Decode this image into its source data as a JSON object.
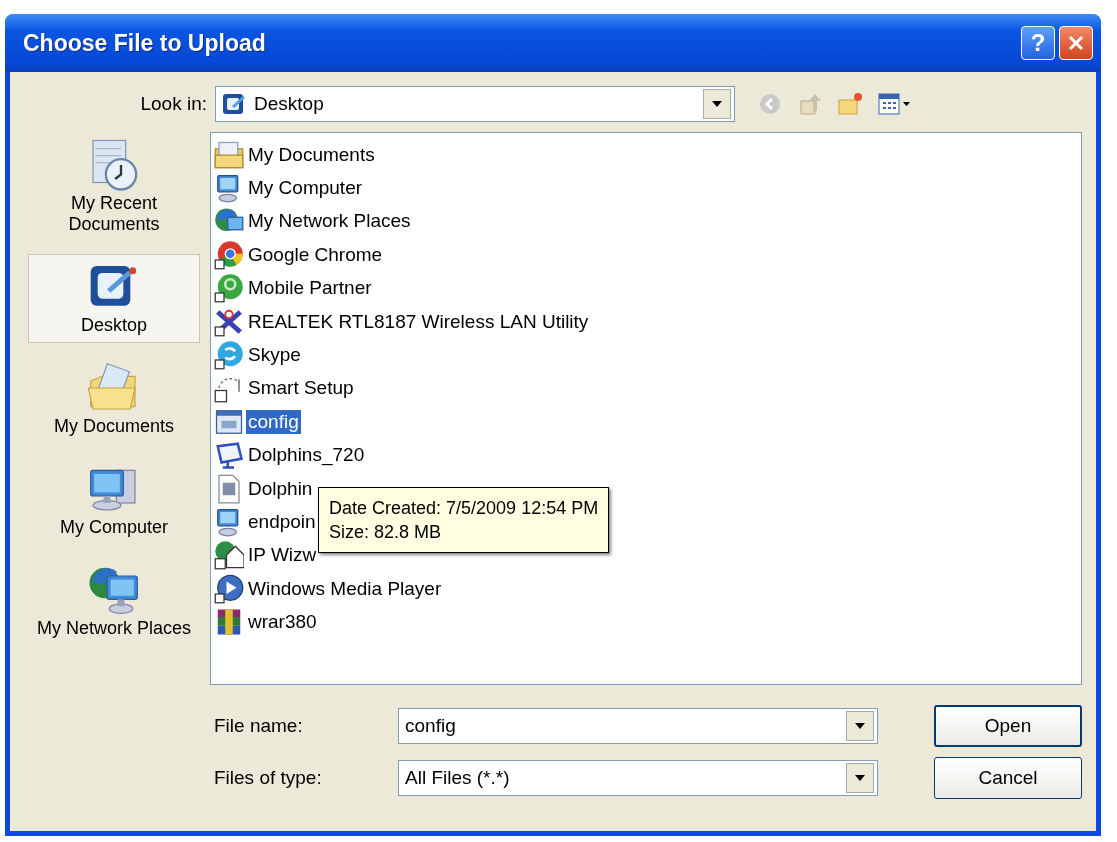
{
  "window": {
    "title": "Choose File to Upload",
    "help_button": "?"
  },
  "look_in": {
    "label": "Look in:",
    "value": "Desktop"
  },
  "places": [
    {
      "label": "My Recent Documents",
      "selected": false
    },
    {
      "label": "Desktop",
      "selected": true
    },
    {
      "label": "My Documents",
      "selected": false
    },
    {
      "label": "My Computer",
      "selected": false
    },
    {
      "label": "My Network Places",
      "selected": false
    }
  ],
  "files": [
    {
      "name": "My Documents",
      "selected": false
    },
    {
      "name": "My Computer",
      "selected": false
    },
    {
      "name": "My Network Places",
      "selected": false
    },
    {
      "name": "Google Chrome",
      "selected": false
    },
    {
      "name": "Mobile Partner",
      "selected": false
    },
    {
      "name": "REALTEK RTL8187 Wireless LAN Utility",
      "selected": false
    },
    {
      "name": "Skype",
      "selected": false
    },
    {
      "name": "Smart Setup",
      "selected": false
    },
    {
      "name": "config",
      "selected": true
    },
    {
      "name": "Dolphins_720",
      "selected": false
    },
    {
      "name": "Dolphin",
      "selected": false
    },
    {
      "name": "endpoin",
      "selected": false
    },
    {
      "name": "IP Wizw",
      "selected": false
    },
    {
      "name": "Windows Media Player",
      "selected": false
    },
    {
      "name": "wrar380",
      "selected": false
    }
  ],
  "tooltip": {
    "lines": [
      "Date Created: 7/5/2009 12:54 PM",
      "Size: 82.8 MB"
    ]
  },
  "file_name": {
    "label": "File name:",
    "value": "config"
  },
  "file_type": {
    "label": "Files of type:",
    "value": "All Files (*.*)"
  },
  "buttons": {
    "open": "Open",
    "cancel": "Cancel"
  }
}
